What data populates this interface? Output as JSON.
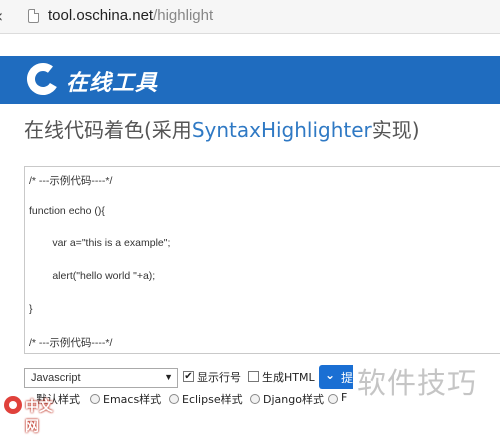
{
  "browser": {
    "url_host": "tool.oschina.net",
    "url_path": "/highlight"
  },
  "header": {
    "logo_text": "在线工具"
  },
  "page": {
    "title_prefix": "在线代码着色(采用",
    "title_highlight": "SyntaxHighlighter",
    "title_suffix": "实现)"
  },
  "code_lines": [
    "/* ---示例代码----*/",
    "function echo (){",
    "        var a=\"this is a example\";",
    "        alert(\"hello world \"+a);",
    "}",
    "/* ---示例代码----*/"
  ],
  "controls": {
    "language": "Javascript",
    "show_line_numbers_label": "显示行号",
    "show_line_numbers_checked": true,
    "generate_html_label": "生成HTML",
    "generate_html_checked": false,
    "submit_label": "提"
  },
  "styles": {
    "default": "默认样式",
    "emacs": "Emacs样式",
    "eclipse": "Eclipse样式",
    "django": "Django样式",
    "more": "F"
  },
  "watermark": {
    "text": "软件技巧",
    "logo_text": "中文网"
  },
  "colors": {
    "header_blue": "#1f6cbf",
    "link_blue": "#2f79c4",
    "button_blue": "#1a6fd3"
  }
}
